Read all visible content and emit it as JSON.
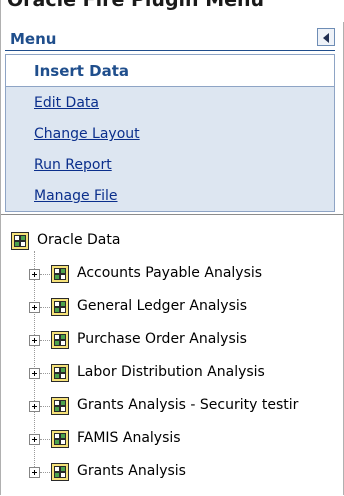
{
  "top_text": "Oracle Fire Plugin Menu",
  "menu": {
    "title": "Menu",
    "items": [
      {
        "label": "Insert Data",
        "active": true
      },
      {
        "label": "Edit Data"
      },
      {
        "label": "Change Layout"
      },
      {
        "label": "Run Report"
      },
      {
        "label": "Manage File"
      }
    ]
  },
  "tree": {
    "root": "Oracle Data",
    "children": [
      {
        "label": "Accounts Payable Analysis"
      },
      {
        "label": "General Ledger Analysis"
      },
      {
        "label": "Purchase Order Analysis"
      },
      {
        "label": "Labor Distribution Analysis"
      },
      {
        "label": "Grants Analysis - Security testir"
      },
      {
        "label": "FAMIS Analysis"
      },
      {
        "label": "Grants Analysis"
      }
    ]
  },
  "colors": {
    "accent": "#1f4e8c",
    "menu_bg": "#dde6f1",
    "link": "#0b2f8c"
  },
  "icons": {
    "collapse": "triangle-left-icon",
    "node": "cube-icon",
    "expand": "plus-box-icon"
  }
}
